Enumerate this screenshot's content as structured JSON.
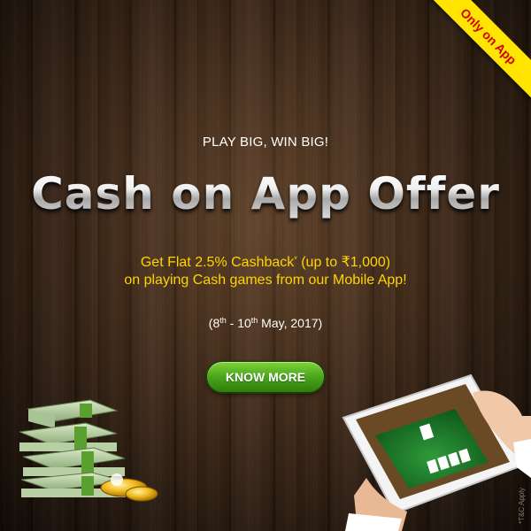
{
  "ribbon": {
    "label": "Only on App",
    "color": "#ffe500",
    "text_color": "#d40000"
  },
  "tagline": "PLAY BIG, WIN BIG!",
  "headline": "Cash on App Offer",
  "offer": {
    "line1_prefix": "Get Flat 2.5% Cashback",
    "line1_mark": "*",
    "line1_suffix": " (up to ₹1,000)",
    "line2": "on playing Cash games from our Mobile App!",
    "color": "#ffd400"
  },
  "dates": {
    "open": "(8",
    "sup1": "th",
    "mid": " - 10",
    "sup2": "th",
    "close": " May, 2017)"
  },
  "cta": {
    "label": "KNOW MORE",
    "color": "#4aa51c"
  },
  "tnc": "*T&C Apply",
  "illustrations": {
    "left": "cash-stacks-and-coins",
    "right": "tablet-in-hands"
  }
}
